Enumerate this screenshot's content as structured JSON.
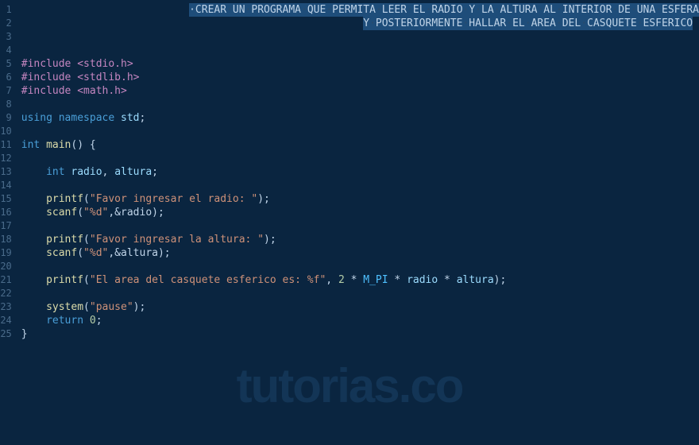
{
  "editor": {
    "lineNumbers": [
      "1",
      "2",
      "3",
      "4",
      "5",
      "6",
      "7",
      "8",
      "9",
      "10",
      "11",
      "12",
      "13",
      "14",
      "15",
      "16",
      "17",
      "18",
      "19",
      "20",
      "21",
      "22",
      "23",
      "24",
      "25"
    ],
    "comment1": "CREAR UN PROGRAMA QUE PERMITA LEER EL RADIO Y LA ALTURA AL INTERIOR DE UNA ESFERA",
    "comment2": "Y POSTERIORMENTE HALLAR EL AREA DEL CASQUETE ESFERICO",
    "include1_kw": "#include ",
    "include1_path": "<stdio.h>",
    "include2_kw": "#include ",
    "include2_path": "<stdlib.h>",
    "include3_kw": "#include ",
    "include3_path": "<math.h>",
    "using_kw": "using",
    "namespace_kw": "namespace",
    "std_id": "std",
    "int_kw": "int",
    "main_fn": "main",
    "radio_id": "radio",
    "altura_id": "altura",
    "printf_fn": "printf",
    "scanf_fn": "scanf",
    "system_fn": "system",
    "str_radio_prompt": "\"Favor ingresar el radio: \"",
    "str_scanf_d": "\"%d\"",
    "str_altura_prompt": "\"Favor ingresar la altura: \"",
    "str_result": "\"El area del casquete esferico es: %f\"",
    "str_pause": "\"pause\"",
    "num_2": "2",
    "num_0": "0",
    "mpi_const": "M_PI",
    "return_kw": "return",
    "amp_radio": ",&radio);",
    "amp_altura": ",&altura);",
    "semicolon": ";",
    "comma_sp": ", ",
    "paren_open": "(",
    "paren_close": ")",
    "brace_open": "{",
    "brace_close": "}",
    "star_sp": " * ",
    "paren_close_sp_brace": "() {",
    "close_paren_semi": ");"
  },
  "watermark": "tutorias.co"
}
